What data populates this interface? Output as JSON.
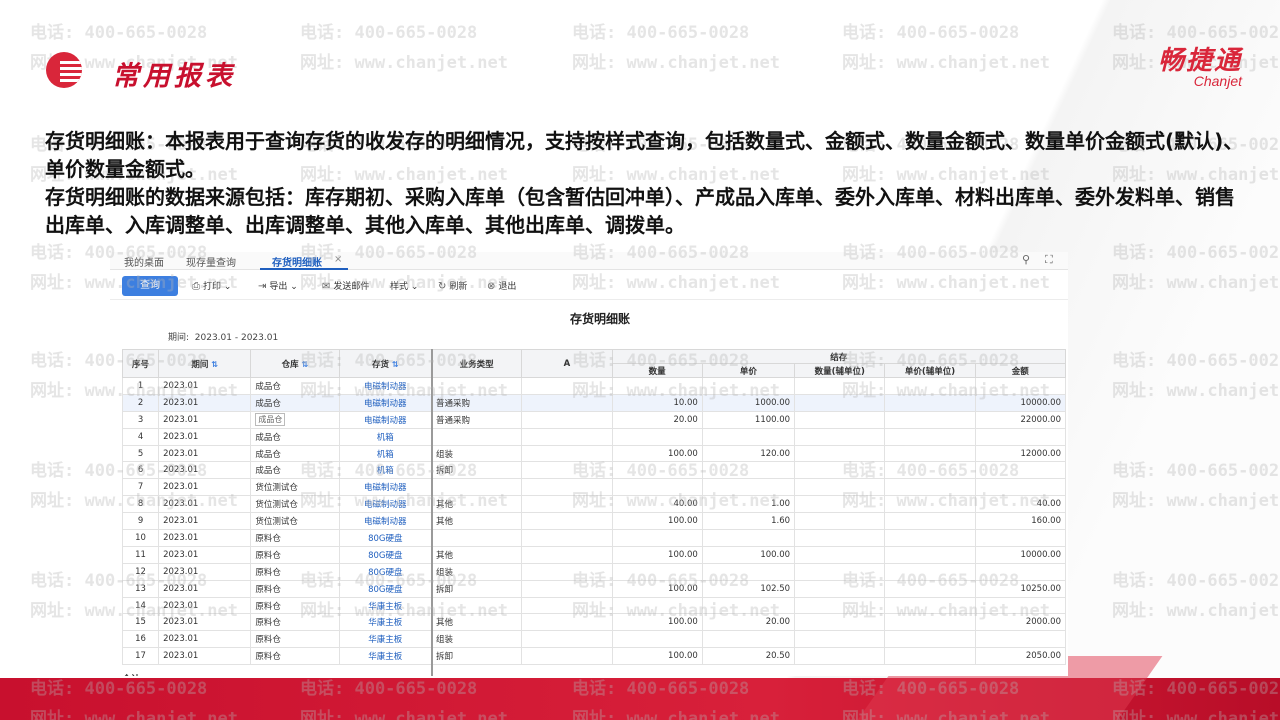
{
  "header": {
    "title": "常用报表",
    "brand_cn": "畅捷通",
    "brand_en": "Chanjet"
  },
  "watermark": {
    "phone": "电话: 400-665-0028",
    "site": "网址: www.chanjet.net"
  },
  "description": {
    "p1": "存货明细账：本报表用于查询存货的收发存的明细情况，支持按样式查询，包括数量式、金额式、数量金额式、数量单价金额式(默认)、单价数量金额式。",
    "p2": "存货明细账的数据来源包括：库存期初、采购入库单（包含暂估回冲单）、产成品入库单、委外入库单、材料出库单、委外发料单、销售出库单、入库调整单、出库调整单、其他入库单、其他出库单、调拨单。"
  },
  "app": {
    "tabs": [
      "我的桌面",
      "现存量查询",
      "存货明细账"
    ],
    "tab_close": "×",
    "toolbar": {
      "query": "查询",
      "print": "打印",
      "export": "导出",
      "email": "发送邮件",
      "style": "样式",
      "refresh": "刷新",
      "exit": "退出"
    },
    "report_title": "存货明细账",
    "period_label": "期间:",
    "period_value": "2023.01 - 2023.01",
    "columns": {
      "seq": "序号",
      "period": "期间",
      "warehouse": "仓库",
      "inventory": "存货",
      "biz_type": "业务类型",
      "a": "A",
      "balance": "结存",
      "qty": "数量",
      "unit_price": "单价",
      "aux_qty": "数量(辅单位)",
      "aux_price": "单价(辅单位)",
      "amount": "金额"
    },
    "ghost_tag": "成品仓",
    "footer_label": "合计",
    "rows": [
      {
        "seq": "1",
        "period": "2023.01",
        "warehouse": "成品仓",
        "inventory": "电磁制动器",
        "biz": "",
        "qty": "",
        "price": "",
        "amount": ""
      },
      {
        "seq": "2",
        "period": "2023.01",
        "warehouse": "成品仓",
        "inventory": "电磁制动器",
        "biz": "普通采购",
        "qty": "10.00",
        "price": "1000.00",
        "amount": "10000.00"
      },
      {
        "seq": "3",
        "period": "2023.01",
        "warehouse": "成品仓",
        "inventory": "电磁制动器",
        "biz": "普通采购",
        "qty": "20.00",
        "price": "1100.00",
        "amount": "22000.00"
      },
      {
        "seq": "4",
        "period": "2023.01",
        "warehouse": "成品仓",
        "inventory": "机箱",
        "biz": "",
        "qty": "",
        "price": "",
        "amount": ""
      },
      {
        "seq": "5",
        "period": "2023.01",
        "warehouse": "成品仓",
        "inventory": "机箱",
        "biz": "组装",
        "qty": "100.00",
        "price": "120.00",
        "amount": "12000.00"
      },
      {
        "seq": "6",
        "period": "2023.01",
        "warehouse": "成品仓",
        "inventory": "机箱",
        "biz": "拆卸",
        "qty": "",
        "price": "",
        "amount": ""
      },
      {
        "seq": "7",
        "period": "2023.01",
        "warehouse": "货位测试仓",
        "inventory": "电磁制动器",
        "biz": "",
        "qty": "",
        "price": "",
        "amount": ""
      },
      {
        "seq": "8",
        "period": "2023.01",
        "warehouse": "货位测试仓",
        "inventory": "电磁制动器",
        "biz": "其他",
        "qty": "40.00",
        "price": "1.00",
        "amount": "40.00"
      },
      {
        "seq": "9",
        "period": "2023.01",
        "warehouse": "货位测试仓",
        "inventory": "电磁制动器",
        "biz": "其他",
        "qty": "100.00",
        "price": "1.60",
        "amount": "160.00"
      },
      {
        "seq": "10",
        "period": "2023.01",
        "warehouse": "原料仓",
        "inventory": "80G硬盘",
        "biz": "",
        "qty": "",
        "price": "",
        "amount": ""
      },
      {
        "seq": "11",
        "period": "2023.01",
        "warehouse": "原料仓",
        "inventory": "80G硬盘",
        "biz": "其他",
        "qty": "100.00",
        "price": "100.00",
        "amount": "10000.00"
      },
      {
        "seq": "12",
        "period": "2023.01",
        "warehouse": "原料仓",
        "inventory": "80G硬盘",
        "biz": "组装",
        "qty": "",
        "price": "",
        "amount": ""
      },
      {
        "seq": "13",
        "period": "2023.01",
        "warehouse": "原料仓",
        "inventory": "80G硬盘",
        "biz": "拆卸",
        "qty": "100.00",
        "price": "102.50",
        "amount": "10250.00"
      },
      {
        "seq": "14",
        "period": "2023.01",
        "warehouse": "原料仓",
        "inventory": "华康主板",
        "biz": "",
        "qty": "",
        "price": "",
        "amount": ""
      },
      {
        "seq": "15",
        "period": "2023.01",
        "warehouse": "原料仓",
        "inventory": "华康主板",
        "biz": "其他",
        "qty": "100.00",
        "price": "20.00",
        "amount": "2000.00"
      },
      {
        "seq": "16",
        "period": "2023.01",
        "warehouse": "原料仓",
        "inventory": "华康主板",
        "biz": "组装",
        "qty": "",
        "price": "",
        "amount": ""
      },
      {
        "seq": "17",
        "period": "2023.01",
        "warehouse": "原料仓",
        "inventory": "华康主板",
        "biz": "拆卸",
        "qty": "100.00",
        "price": "20.50",
        "amount": "2050.00"
      }
    ]
  }
}
